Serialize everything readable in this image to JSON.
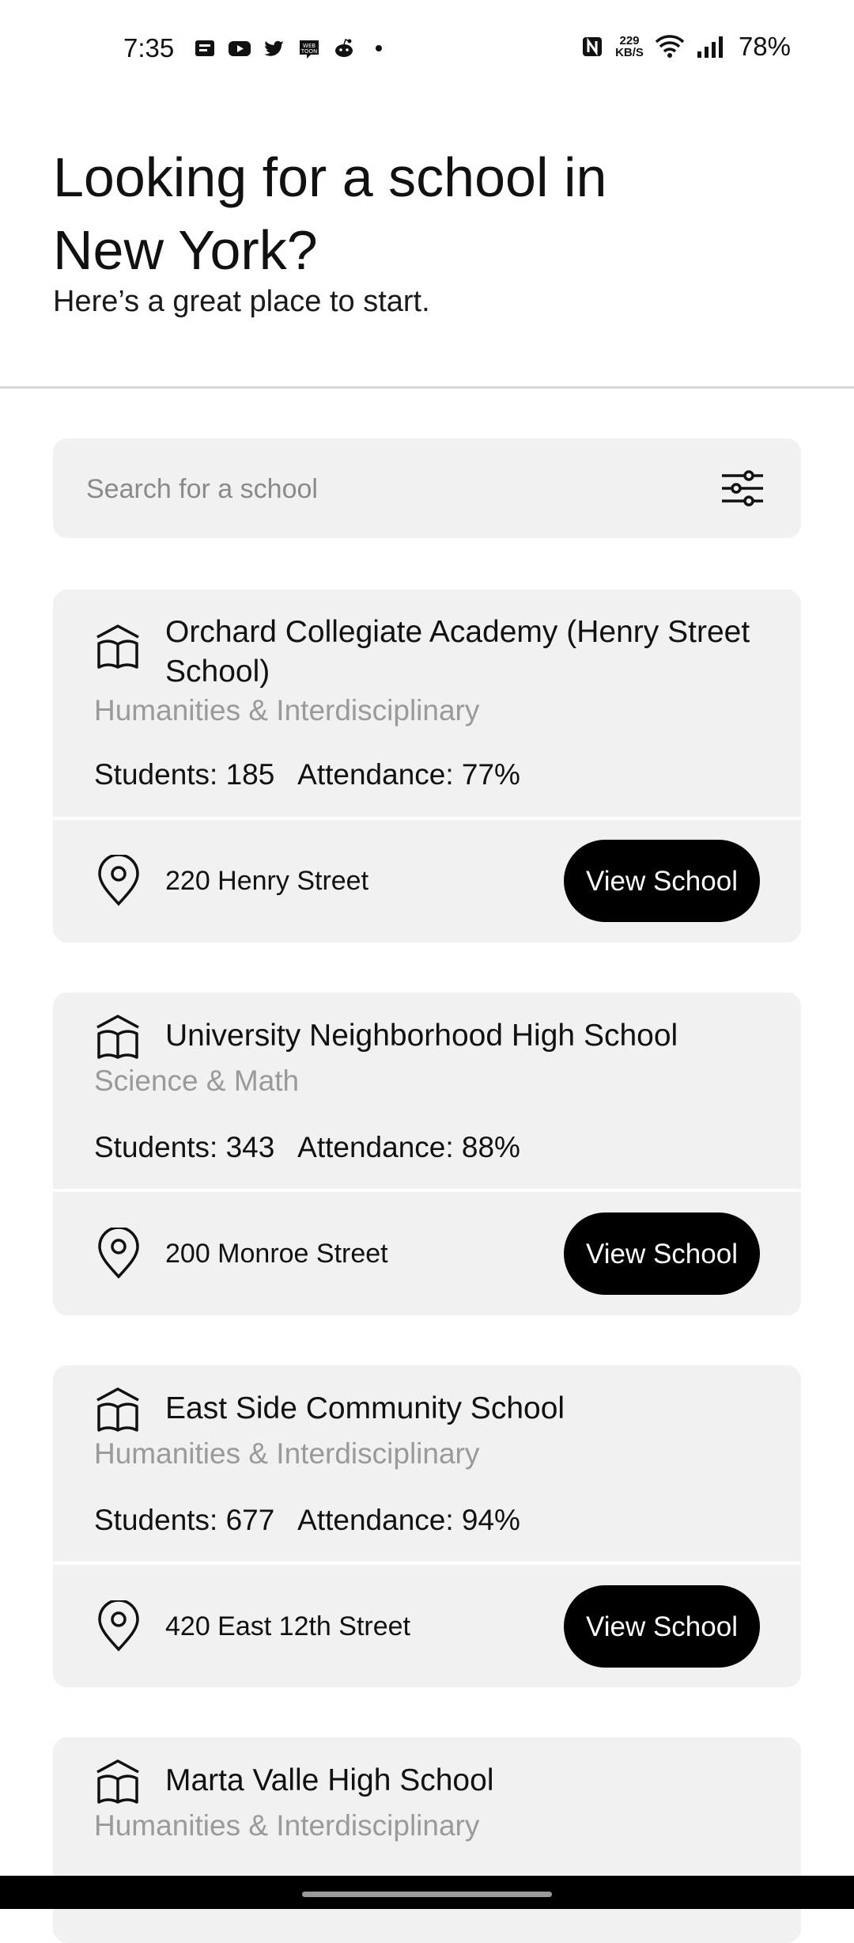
{
  "status_bar": {
    "time": "7:35",
    "left_icons": [
      "news-icon",
      "youtube-icon",
      "twitter-icon",
      "webtoon-icon",
      "reddit-icon",
      "dot-icon"
    ],
    "net_speed_value": "229",
    "net_speed_unit": "KB/S",
    "right_icons": [
      "nfc-icon",
      "wifi-icon",
      "signal-icon"
    ],
    "battery": "78%"
  },
  "header": {
    "title_line1": "Looking for a school in",
    "title_city": "New York?",
    "subtitle": "Here’s a great place to start."
  },
  "search": {
    "placeholder": "Search for a school",
    "value": "",
    "filter_icon": "sliders-icon"
  },
  "schools": [
    {
      "name": "Orchard Collegiate Academy (Henry Street School)",
      "category": "Humanities & Interdisciplinary",
      "stats": "Students: 185   Attendance: 77%",
      "address": "220 Henry Street",
      "button": "View School"
    },
    {
      "name": "University Neighborhood High School",
      "category": "Science & Math",
      "stats": "Students: 343   Attendance: 88%",
      "address": "200 Monroe Street",
      "button": "View School"
    },
    {
      "name": "East Side Community School",
      "category": "Humanities & Interdisciplinary",
      "stats": "Students: 677   Attendance: 94%",
      "address": "420 East 12th Street",
      "button": "View School"
    },
    {
      "name": "Marta Valle High School",
      "category": "Humanities & Interdisciplinary"
    }
  ],
  "colors": {
    "card_bg": "#f1f1f1",
    "button_bg": "#000000",
    "muted_text": "#9a9a9a"
  }
}
